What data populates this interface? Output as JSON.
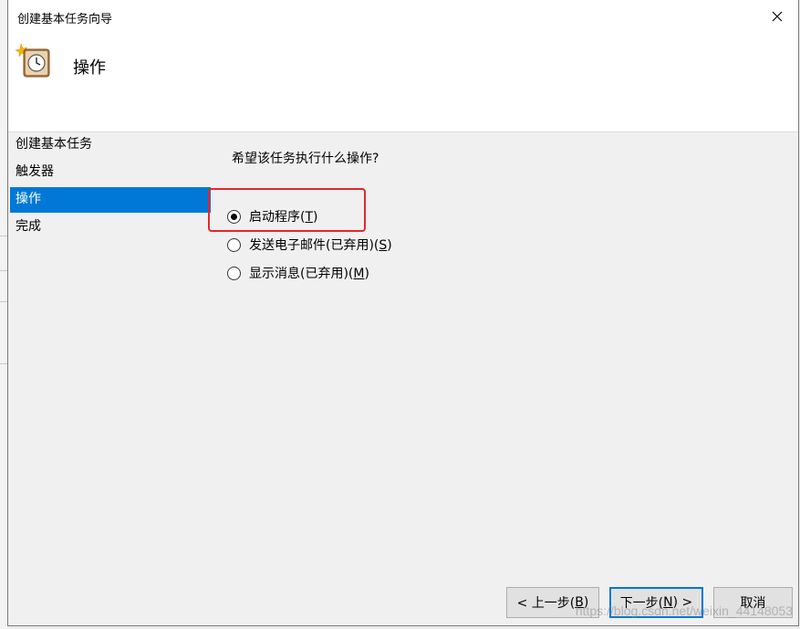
{
  "window": {
    "title": "创建基本任务向导"
  },
  "header": {
    "title": "操作",
    "icon": "clock-icon"
  },
  "steps": [
    {
      "label": "创建基本任务",
      "active": false
    },
    {
      "label": "触发器",
      "active": false
    },
    {
      "label": "操作",
      "active": true
    },
    {
      "label": "完成",
      "active": false
    }
  ],
  "main": {
    "question": "希望该任务执行什么操作?",
    "options": [
      {
        "label": "启动程序(",
        "key": "T",
        "suffix": ")",
        "checked": true
      },
      {
        "label": "发送电子邮件(已弃用)(",
        "key": "S",
        "suffix": ")",
        "checked": false
      },
      {
        "label": "显示消息(已弃用)(",
        "key": "M",
        "suffix": ")",
        "checked": false
      }
    ]
  },
  "buttons": {
    "back": {
      "pre": "< 上一步(",
      "key": "B",
      "post": ")"
    },
    "next": {
      "pre": "下一步(",
      "key": "N",
      "post": ") >"
    },
    "cancel": {
      "label": "取消"
    }
  },
  "watermark": "https://blog.csdn.net/weixin_44148053",
  "colors": {
    "selection": "#0078d7",
    "highlight_box": "#e8262a"
  }
}
